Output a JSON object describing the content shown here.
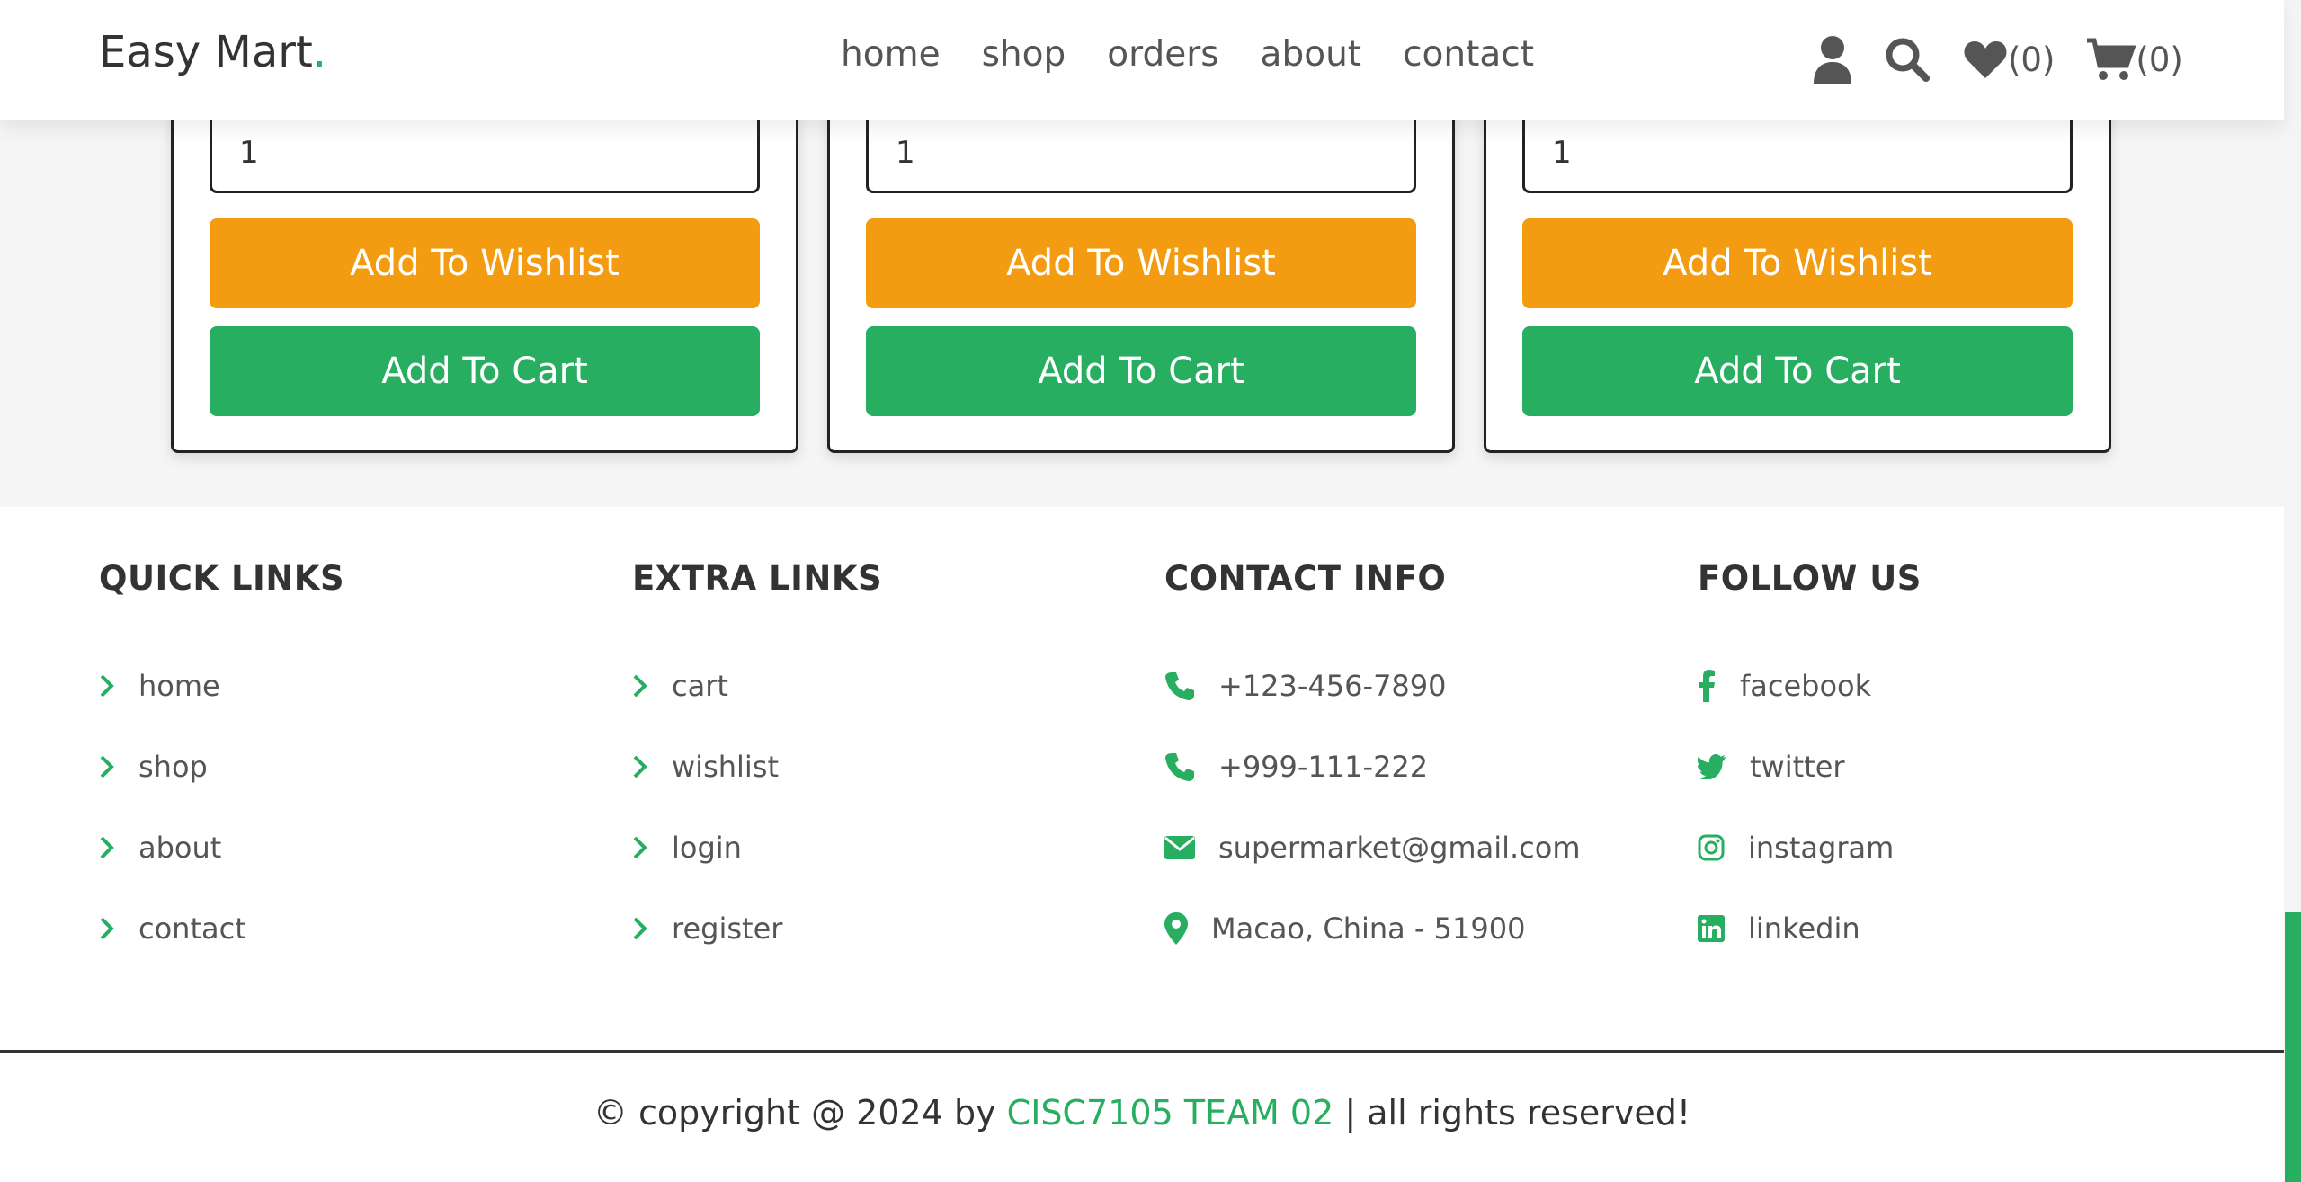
{
  "header": {
    "logo_text": "Easy Mart",
    "logo_dot": ".",
    "nav": [
      "home",
      "shop",
      "orders",
      "about",
      "contact"
    ],
    "wishlist_count": "(0)",
    "cart_count": "(0)"
  },
  "products": [
    {
      "qty": "1",
      "wishlist_label": "Add To Wishlist",
      "cart_label": "Add To Cart"
    },
    {
      "qty": "1",
      "wishlist_label": "Add To Wishlist",
      "cart_label": "Add To Cart"
    },
    {
      "qty": "1",
      "wishlist_label": "Add To Wishlist",
      "cart_label": "Add To Cart"
    }
  ],
  "footer": {
    "quick_links": {
      "title": "QUICK LINKS",
      "items": [
        "home",
        "shop",
        "about",
        "contact"
      ]
    },
    "extra_links": {
      "title": "EXTRA LINKS",
      "items": [
        "cart",
        "wishlist",
        "login",
        "register"
      ]
    },
    "contact_info": {
      "title": "CONTACT INFO",
      "items": [
        "+123-456-7890",
        "+999-111-222",
        "supermarket@gmail.com",
        "Macao, China - 51900"
      ]
    },
    "follow_us": {
      "title": "FOLLOW US",
      "items": [
        "facebook",
        "twitter",
        "instagram",
        "linkedin"
      ]
    },
    "credit_prefix": "© copyright @ 2024 by",
    "credit_team": "CISC7105 TEAM 02",
    "credit_suffix": "| all rights reserved!"
  },
  "colors": {
    "accent": "#27ae60",
    "wishlist": "#f39c12",
    "text": "#333333"
  }
}
